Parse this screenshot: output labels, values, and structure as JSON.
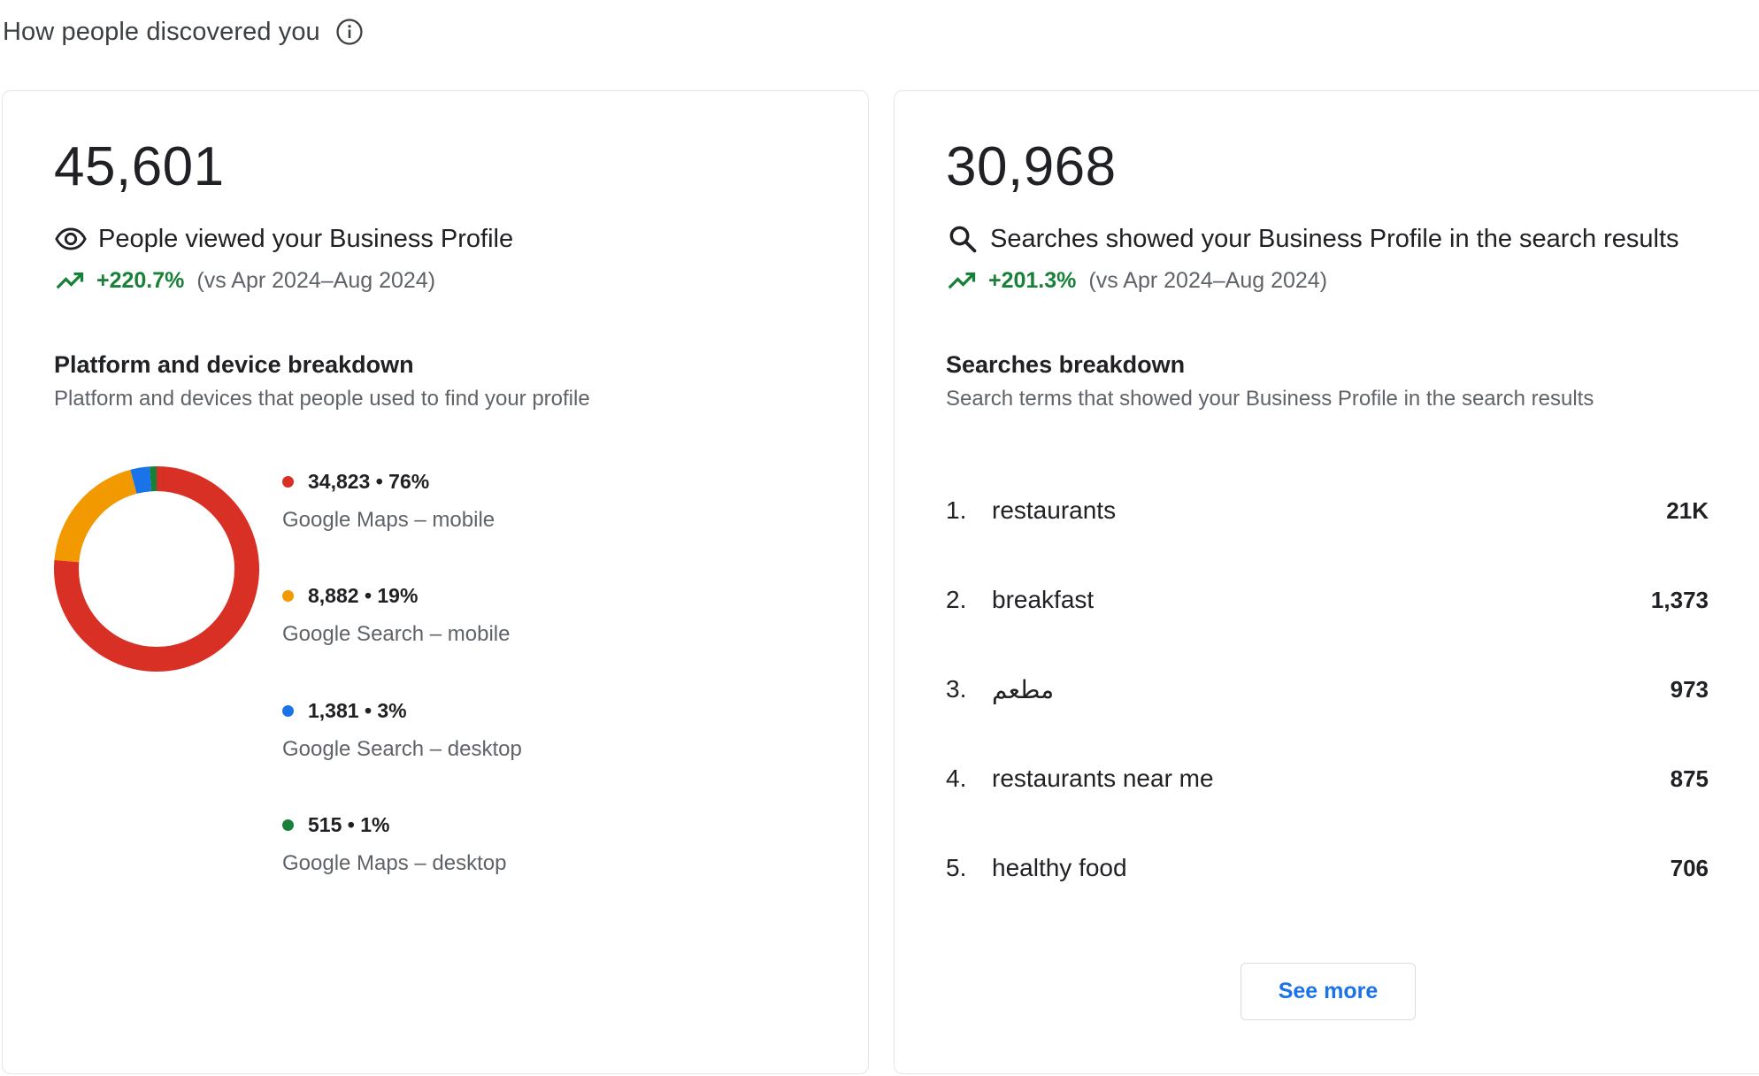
{
  "header": {
    "title": "How people discovered you",
    "info_icon": "info-icon"
  },
  "left_card": {
    "total": "45,601",
    "metric_label": "People viewed your Business Profile",
    "metric_icon": "eye-icon",
    "trend_pct": "+220.7%",
    "trend_compare": "(vs Apr 2024–Aug 2024)",
    "breakdown_title": "Platform and device breakdown",
    "breakdown_desc": "Platform and devices that people used to find your profile",
    "legend": [
      {
        "value": "34,823 • 76%",
        "label": "Google Maps – mobile",
        "color": "#d93025"
      },
      {
        "value": "8,882 • 19%",
        "label": "Google Search – mobile",
        "color": "#f29900"
      },
      {
        "value": "1,381 • 3%",
        "label": "Google Search – desktop",
        "color": "#1a73e8"
      },
      {
        "value": "515 • 1%",
        "label": "Google Maps – desktop",
        "color": "#188038"
      }
    ]
  },
  "chart_data": {
    "type": "pie",
    "categories": [
      "Google Maps – mobile",
      "Google Search – mobile",
      "Google Search – desktop",
      "Google Maps – desktop"
    ],
    "values": [
      34823,
      8882,
      1381,
      515
    ],
    "percentages": [
      76,
      19,
      3,
      1
    ],
    "colors": [
      "#d93025",
      "#f29900",
      "#1a73e8",
      "#188038"
    ],
    "donut": true,
    "legend_position": "right"
  },
  "right_card": {
    "total": "30,968",
    "metric_label": "Searches showed your Business Profile in the search results",
    "metric_icon": "search-icon",
    "trend_pct": "+201.3%",
    "trend_compare": "(vs Apr 2024–Aug 2024)",
    "breakdown_title": "Searches breakdown",
    "breakdown_desc": "Search terms that showed your Business Profile in the search results",
    "searches": [
      {
        "rank": "1.",
        "term": "restaurants",
        "count": "21K"
      },
      {
        "rank": "2.",
        "term": "breakfast",
        "count": "1,373"
      },
      {
        "rank": "3.",
        "term": "مطعم",
        "count": "973"
      },
      {
        "rank": "4.",
        "term": "restaurants near me",
        "count": "875"
      },
      {
        "rank": "5.",
        "term": "healthy food",
        "count": "706"
      }
    ],
    "see_more_label": "See more"
  }
}
